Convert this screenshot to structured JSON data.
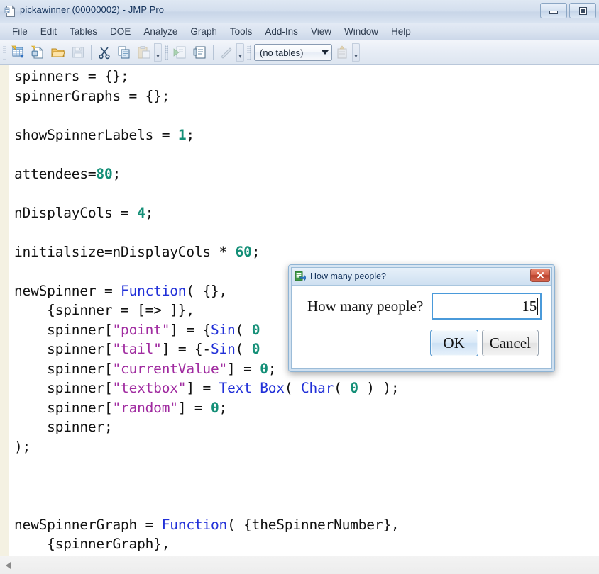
{
  "window": {
    "title": "pickawinner (00000002) - JMP Pro",
    "app_icon": "script-document-icon",
    "buttons": {
      "minimize": "Minimize",
      "restore": "Restore"
    }
  },
  "menubar": {
    "items": [
      {
        "label": "File"
      },
      {
        "label": "Edit"
      },
      {
        "label": "Tables"
      },
      {
        "label": "DOE"
      },
      {
        "label": "Analyze"
      },
      {
        "label": "Graph"
      },
      {
        "label": "Tools"
      },
      {
        "label": "Add-Ins"
      },
      {
        "label": "View"
      },
      {
        "label": "Window"
      },
      {
        "label": "Help"
      }
    ]
  },
  "toolbar": {
    "groups": [
      {
        "name": "file-group",
        "buttons": [
          {
            "name": "new-data-table-icon",
            "tip": "New Data Table"
          },
          {
            "name": "new-script-icon",
            "tip": "New Script"
          },
          {
            "name": "open-folder-icon",
            "tip": "Open"
          },
          {
            "name": "save-icon",
            "tip": "Save",
            "disabled": true
          }
        ]
      },
      {
        "name": "clipboard-group",
        "buttons": [
          {
            "name": "cut-scissors-icon",
            "tip": "Cut"
          },
          {
            "name": "copy-icon",
            "tip": "Copy"
          },
          {
            "name": "paste-icon",
            "tip": "Paste",
            "disabled": true
          }
        ]
      },
      {
        "name": "script-group",
        "buttons": [
          {
            "name": "run-script-icon",
            "tip": "Run Script",
            "disabled": true
          },
          {
            "name": "debug-script-icon",
            "tip": "Debug Script"
          },
          {
            "name": "edit-formula-icon",
            "tip": "Edit",
            "disabled": true
          }
        ]
      },
      {
        "name": "table-group",
        "buttons": [
          {
            "name": "current-table-combo",
            "tip": "Current Data Table"
          },
          {
            "name": "table-properties-icon",
            "tip": "Table Properties",
            "disabled": true
          }
        ]
      }
    ],
    "table_combo": {
      "selected": "(no tables)",
      "options": [
        "(no tables)"
      ]
    },
    "overflow_glyph": "»"
  },
  "editor": {
    "lines": [
      [
        {
          "t": "spinners = {};",
          "c": "plain"
        }
      ],
      [
        {
          "t": "spinnerGraphs = {};",
          "c": "plain"
        }
      ],
      [
        {
          "t": "",
          "c": "plain"
        }
      ],
      [
        {
          "t": "showSpinnerLabels = ",
          "c": "plain"
        },
        {
          "t": "1",
          "c": "num"
        },
        {
          "t": ";",
          "c": "plain"
        }
      ],
      [
        {
          "t": "",
          "c": "plain"
        }
      ],
      [
        {
          "t": "attendees=",
          "c": "plain"
        },
        {
          "t": "80",
          "c": "num"
        },
        {
          "t": ";",
          "c": "plain"
        }
      ],
      [
        {
          "t": "",
          "c": "plain"
        }
      ],
      [
        {
          "t": "nDisplayCols = ",
          "c": "plain"
        },
        {
          "t": "4",
          "c": "num"
        },
        {
          "t": ";",
          "c": "plain"
        }
      ],
      [
        {
          "t": "",
          "c": "plain"
        }
      ],
      [
        {
          "t": "initialsize=nDisplayCols * ",
          "c": "plain"
        },
        {
          "t": "60",
          "c": "num"
        },
        {
          "t": ";",
          "c": "plain"
        }
      ],
      [
        {
          "t": "",
          "c": "plain"
        }
      ],
      [
        {
          "t": "newSpinner = ",
          "c": "plain"
        },
        {
          "t": "Function",
          "c": "fn"
        },
        {
          "t": "( {},",
          "c": "plain"
        }
      ],
      [
        {
          "t": "    {spinner = [=> ]},",
          "c": "plain"
        }
      ],
      [
        {
          "t": "    spinner[",
          "c": "plain"
        },
        {
          "t": "\"point\"",
          "c": "str"
        },
        {
          "t": "] = {",
          "c": "plain"
        },
        {
          "t": "Sin",
          "c": "fn"
        },
        {
          "t": "( ",
          "c": "plain"
        },
        {
          "t": "0",
          "c": "num"
        }
      ],
      [
        {
          "t": "    spinner[",
          "c": "plain"
        },
        {
          "t": "\"tail\"",
          "c": "str"
        },
        {
          "t": "] = {-",
          "c": "plain"
        },
        {
          "t": "Sin",
          "c": "fn"
        },
        {
          "t": "( ",
          "c": "plain"
        },
        {
          "t": "0",
          "c": "num"
        }
      ],
      [
        {
          "t": "    spinner[",
          "c": "plain"
        },
        {
          "t": "\"currentValue\"",
          "c": "str"
        },
        {
          "t": "] = ",
          "c": "plain"
        },
        {
          "t": "0",
          "c": "num"
        },
        {
          "t": ";",
          "c": "plain"
        }
      ],
      [
        {
          "t": "    spinner[",
          "c": "plain"
        },
        {
          "t": "\"textbox\"",
          "c": "str"
        },
        {
          "t": "] = ",
          "c": "plain"
        },
        {
          "t": "Text Box",
          "c": "fn"
        },
        {
          "t": "( ",
          "c": "plain"
        },
        {
          "t": "Char",
          "c": "fn"
        },
        {
          "t": "( ",
          "c": "plain"
        },
        {
          "t": "0",
          "c": "num"
        },
        {
          "t": " ) );",
          "c": "plain"
        }
      ],
      [
        {
          "t": "    spinner[",
          "c": "plain"
        },
        {
          "t": "\"random\"",
          "c": "str"
        },
        {
          "t": "] = ",
          "c": "plain"
        },
        {
          "t": "0",
          "c": "num"
        },
        {
          "t": ";",
          "c": "plain"
        }
      ],
      [
        {
          "t": "    spinner;",
          "c": "plain"
        }
      ],
      [
        {
          "t": ");",
          "c": "plain"
        }
      ],
      [
        {
          "t": "",
          "c": "plain"
        }
      ],
      [
        {
          "t": "",
          "c": "plain"
        }
      ],
      [
        {
          "t": "",
          "c": "plain"
        }
      ],
      [
        {
          "t": "newSpinnerGraph = ",
          "c": "plain"
        },
        {
          "t": "Function",
          "c": "fn"
        },
        {
          "t": "( {theSpinnerNumber},",
          "c": "plain"
        }
      ],
      [
        {
          "t": "    {spinnerGraph},",
          "c": "plain"
        }
      ]
    ],
    "colors": {
      "number": "#148f77",
      "string": "#a02ba0",
      "function": "#2130d8",
      "plain": "#111111",
      "gutter": "#f4f1e2"
    }
  },
  "scrollbar": {
    "left_arrow": "scroll-left-arrow"
  },
  "dialog": {
    "icon": "jmp-script-icon",
    "title": "How many people?",
    "close_label": "Close",
    "prompt_label": "How many people?",
    "input_value": "15",
    "ok_label": "OK",
    "cancel_label": "Cancel"
  }
}
